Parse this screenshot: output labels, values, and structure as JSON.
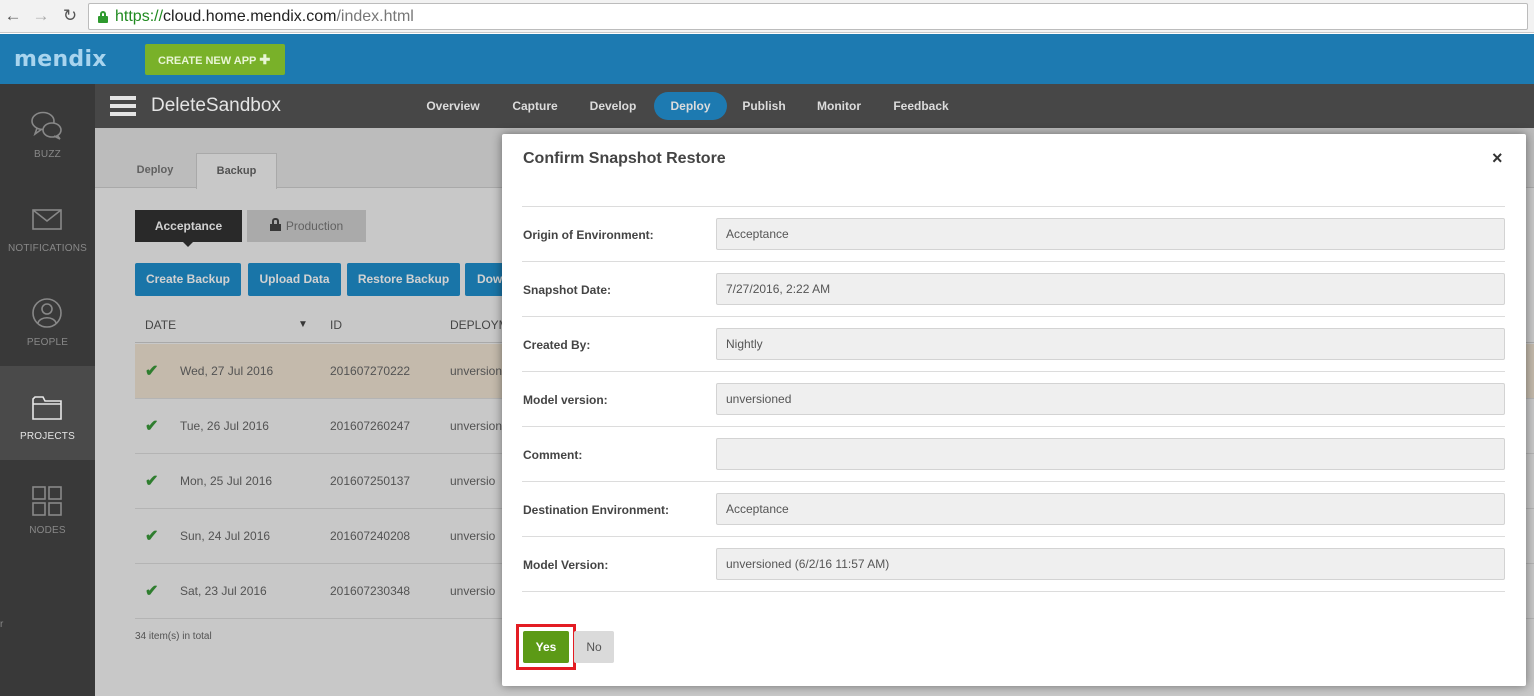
{
  "browser": {
    "url_scheme": "https://",
    "url_host": "cloud.home.mendix.com",
    "url_path": "/index.html",
    "back_icon": "←",
    "forward_icon": "→",
    "reload_icon": "↻"
  },
  "header": {
    "logo": "mendix",
    "create_app_label": "CREATE NEW APP",
    "create_app_icon": "✚",
    "colors": {
      "header_bg": "#1d7ab1",
      "create_btn": "#79b129"
    }
  },
  "sidebar": {
    "items": [
      {
        "label": "BUZZ",
        "icon": "chat-bubbles-icon"
      },
      {
        "label": "NOTIFICATIONS",
        "icon": "envelope-icon"
      },
      {
        "label": "PEOPLE",
        "icon": "person-icon"
      },
      {
        "label": "PROJECTS",
        "icon": "folder-icon",
        "active": true
      },
      {
        "label": "NODES",
        "icon": "grid-icon"
      }
    ],
    "footer": "r"
  },
  "app_bar": {
    "title": "DeleteSandbox",
    "tabs": [
      {
        "label": "Overview"
      },
      {
        "label": "Capture"
      },
      {
        "label": "Develop"
      },
      {
        "label": "Deploy",
        "active": true
      },
      {
        "label": "Publish"
      },
      {
        "label": "Monitor"
      },
      {
        "label": "Feedback"
      }
    ]
  },
  "page": {
    "sub_tabs": [
      {
        "label": "Deploy"
      },
      {
        "label": "Backup",
        "active": true
      }
    ],
    "env_buttons": {
      "acceptance": "Acceptance",
      "production": "Production"
    },
    "actions": {
      "create_backup": "Create Backup",
      "upload_data": "Upload Data",
      "restore_backup": "Restore Backup",
      "download": "Dow"
    },
    "table": {
      "headers": {
        "date": "DATE",
        "id": "ID",
        "deployment": "DEPLOYM"
      },
      "sort_icon": "▼",
      "rows": [
        {
          "date": "Wed, 27 Jul 2016",
          "id": "201607270222",
          "deployment": "unversion"
        },
        {
          "date": "Tue, 26 Jul 2016",
          "id": "201607260247",
          "deployment": "unversion"
        },
        {
          "date": "Mon, 25 Jul 2016",
          "id": "201607250137",
          "deployment": "unversio"
        },
        {
          "date": "Sun, 24 Jul 2016",
          "id": "201607240208",
          "deployment": "unversio"
        },
        {
          "date": "Sat, 23 Jul 2016",
          "id": "201607230348",
          "deployment": "unversio"
        }
      ],
      "check_icon": "✔",
      "total": "34 item(s) in total"
    }
  },
  "modal": {
    "title": "Confirm Snapshot Restore",
    "close_icon": "×",
    "fields": [
      {
        "label": "Origin of Environment:",
        "value": "Acceptance"
      },
      {
        "label": "Snapshot Date:",
        "value": "7/27/2016, 2:22 AM"
      },
      {
        "label": "Created By:",
        "value": "Nightly"
      },
      {
        "label": "Model version:",
        "value": "unversioned"
      },
      {
        "label": "Comment:",
        "value": ""
      },
      {
        "label": "Destination Environment:",
        "value": "Acceptance"
      },
      {
        "label": "Model Version:",
        "value": "unversioned (6/2/16 11:57 AM)"
      }
    ],
    "yes_label": "Yes",
    "no_label": "No",
    "colors": {
      "yes_btn": "#5c9a16",
      "highlight": "#e31c23"
    }
  }
}
